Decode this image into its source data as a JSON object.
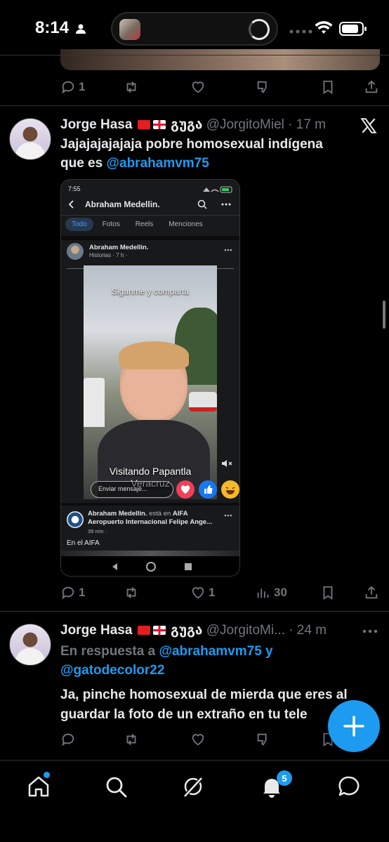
{
  "status_bar": {
    "time": "8:14"
  },
  "tweet_prev": {
    "reply_count": "1"
  },
  "tweet1": {
    "display_name": "Jorge Hasa",
    "name_suffix": "გუგა",
    "handle": "@JorgitoMiel",
    "time": "· 17 m",
    "text_1": "Jajajajajajaja pobre homosexual indígena",
    "text_2": "que es ",
    "mention": "@abrahamvm75",
    "reply_count": "1",
    "like_count": "1",
    "view_count": "30",
    "embedded": {
      "clock": "7:55",
      "page_title": "Abraham Medellin.",
      "tabs": [
        "Todo",
        "Fotos",
        "Reels",
        "Menciones"
      ],
      "post_author": "Abraham Medellin.",
      "post_meta": "Historias · 7 h ·",
      "overlay_top": "Siganme y comparta",
      "overlay_bottom_1": "Visitando Papantla",
      "overlay_bottom_2": "Veracruz",
      "send_message": "Enviar mensaje...",
      "checkin_author": "Abraham Medellin.",
      "checkin_connector": " está en ",
      "checkin_place_1": "AIFA",
      "checkin_place_2": "Aeropuerto Internacional Felipe Ange...",
      "checkin_meta": "39 min ·",
      "checkin_caption": "En el AIFA"
    }
  },
  "tweet2": {
    "display_name": "Jorge Hasa",
    "name_suffix": "გუგა",
    "handle": "@JorgitoMi...",
    "time": "· 24 m",
    "reply_prefix": "En respuesta a ",
    "reply_mention_1": "@abrahamvm75",
    "reply_and": " y",
    "reply_mention_2": "@gatodecolor22",
    "text_1": "Ja, pinche homosexual de mierda que eres al",
    "text_2": "guardar la foto de un extraño en tu tele"
  },
  "tabbar": {
    "notifications_badge": "5"
  },
  "colors": {
    "accent": "#1d9bf0",
    "muted": "#71767b",
    "background": "#000000"
  }
}
